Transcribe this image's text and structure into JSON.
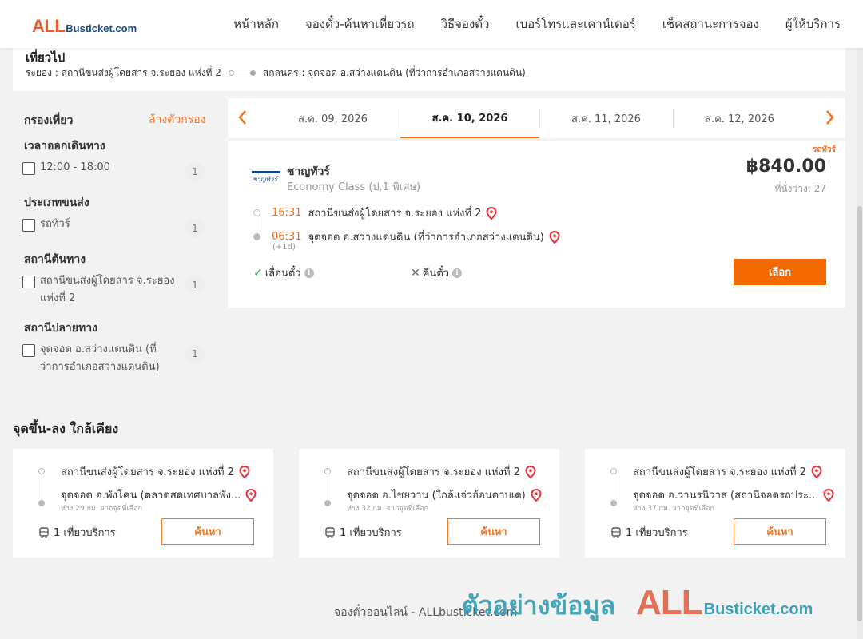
{
  "logo": {
    "all": "ALL",
    "rest": "Busticket.com"
  },
  "nav": [
    "หน้าหลัก",
    "จองตั๋ว-ค้นหาเที่ยวรถ",
    "วิธีจองตั๋ว",
    "เบอร์โทรและเคาน์เตอร์",
    "เช็คสถานะการจอง",
    "ผู้ให้บริการ"
  ],
  "route": {
    "title": "เที่ยวไป",
    "from": "ระยอง : สถานีขนส่งผู้โดยสาร จ.ระยอง แห่งที่ 2",
    "to": "สกลนคร : จุดจอด อ.สว่างแดนดิน (ที่ว่าการอำเภอสว่างแดนดิน)"
  },
  "filter": {
    "title": "กรองเที่ยว",
    "clear": "ล้างตัวกรอง",
    "sections": [
      {
        "title": "เวลาออกเดินทาง",
        "options": [
          {
            "label": "12:00 - 18:00",
            "count": "1"
          }
        ]
      },
      {
        "title": "ประเภทขนส่ง",
        "options": [
          {
            "label": "รถทัวร์",
            "count": "1"
          }
        ]
      },
      {
        "title": "สถานีต้นทาง",
        "options": [
          {
            "label": "สถานีขนส่งผู้โดยสาร จ.ระยอง แห่งที่ 2",
            "count": "1"
          }
        ]
      },
      {
        "title": "สถานีปลายทาง",
        "options": [
          {
            "label": "จุดจอด อ.สว่างแดนดิน (ที่ว่าการอำเภอสว่างแดนดิน)",
            "count": "1"
          }
        ]
      }
    ]
  },
  "dates": {
    "prev": "‹",
    "next": "›",
    "tabs": [
      "ส.ค. 09, 2026",
      "ส.ค. 10, 2026",
      "ส.ค. 11, 2026",
      "ส.ค. 12, 2026"
    ],
    "active_index": 1
  },
  "trip": {
    "tag": "รถทัวร์",
    "operator": "ชาญทัวร์",
    "class": "Economy Class (ป.1 พิเศษ)",
    "price": "฿840.00",
    "seats": "ที่นั่งว่าง: 27",
    "depart_time": "16:31",
    "depart_station": "สถานีขนส่งผู้โดยสาร จ.ระยอง แห่งที่ 2",
    "arrive_time": "06:31",
    "arrive_station": "จุดจอด อ.สว่างแดนดิน (ที่ว่าการอำเภอสว่างแดนดิน)",
    "next_day": "(+1d)",
    "reschedule": "เลื่อนตั๋ว",
    "refund": "คืนตั๋ว",
    "select": "เลือก",
    "colors": {
      "accent": "#f56a00",
      "time": "#e36f1e"
    }
  },
  "nearby": {
    "title": "จุดขึ้น-ลง ใกล้เคียง",
    "cards": [
      {
        "from": "สถานีขนส่งผู้โดยสาร จ.ระยอง แห่งที่ 2",
        "to": "จุดจอด อ.พังโคน (ตลาดสดเทศบาลพัง...",
        "distance": "ห่าง 29 กม. จากจุดที่เลือก",
        "services": "1 เที่ยวบริการ",
        "button": "ค้นหา"
      },
      {
        "from": "สถานีขนส่งผู้โดยสาร จ.ระยอง แห่งที่ 2",
        "to": "จุดจอด อ.ไชยวาน (ใกล้แจ่วฮ้อนดาบเด)",
        "distance": "ห่าง 32 กม. จากจุดที่เลือก",
        "services": "1 เที่ยวบริการ",
        "button": "ค้นหา"
      },
      {
        "from": "สถานีขนส่งผู้โดยสาร จ.ระยอง แห่งที่ 2",
        "to": "จุดจอด อ.วานรนิวาส (สถานีจอดรถประ...",
        "distance": "ห่าง 37 กม. จากจุดที่เลือก",
        "services": "1 เที่ยวบริการ",
        "button": "ค้นหา"
      }
    ]
  },
  "footer": {
    "text": "จองตั๋วออนไลน์ - ALLbusticket.com"
  },
  "watermark": {
    "thai": "ตัวอย่างข้อมูล",
    "all": "ALL",
    "rest": "Busticket.com"
  }
}
